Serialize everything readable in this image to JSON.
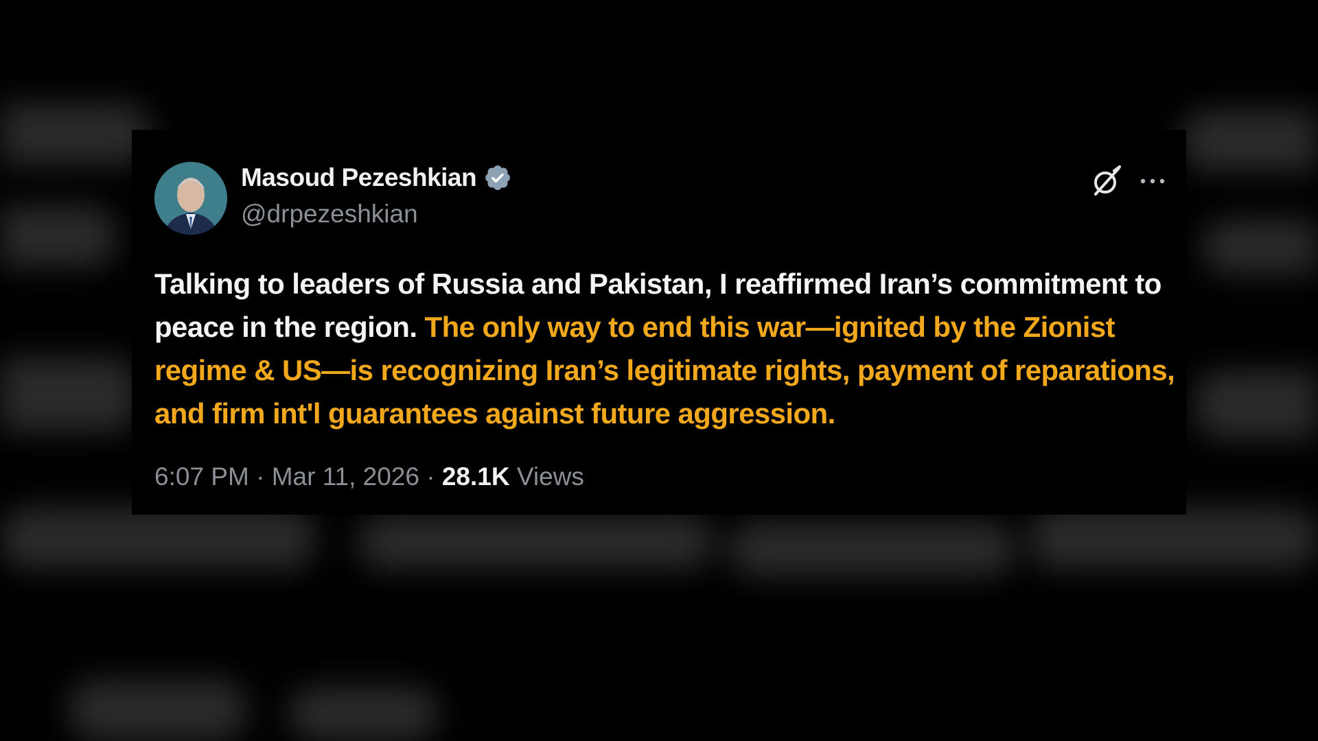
{
  "tweet": {
    "author": {
      "display_name": "Masoud Pezeshkian",
      "handle": "@drpezeshkian",
      "verified": true,
      "verified_icon": "verified-badge-icon"
    },
    "text_plain": "Talking to leaders of Russia and Pakistan, I reaffirmed Iran’s commitment to peace in the region.",
    "text_highlighted": "The only way to end this war—ignited by the Zionist regime & US—is recognizing Iran’s legitimate rights, payment of reparations, and firm int'l guarantees against future aggression.",
    "time": "6:07 PM",
    "date": "Mar 11, 2026",
    "separator": "·",
    "views_count": "28.1K",
    "views_label": "Views"
  },
  "icons": {
    "grok": "grok-icon",
    "more": "more-options-icon"
  },
  "colors": {
    "background": "#000000",
    "text": "#f4f4f4",
    "highlight": "#f2a81d",
    "secondary": "#8b9096",
    "verified": "#8da1b5"
  }
}
